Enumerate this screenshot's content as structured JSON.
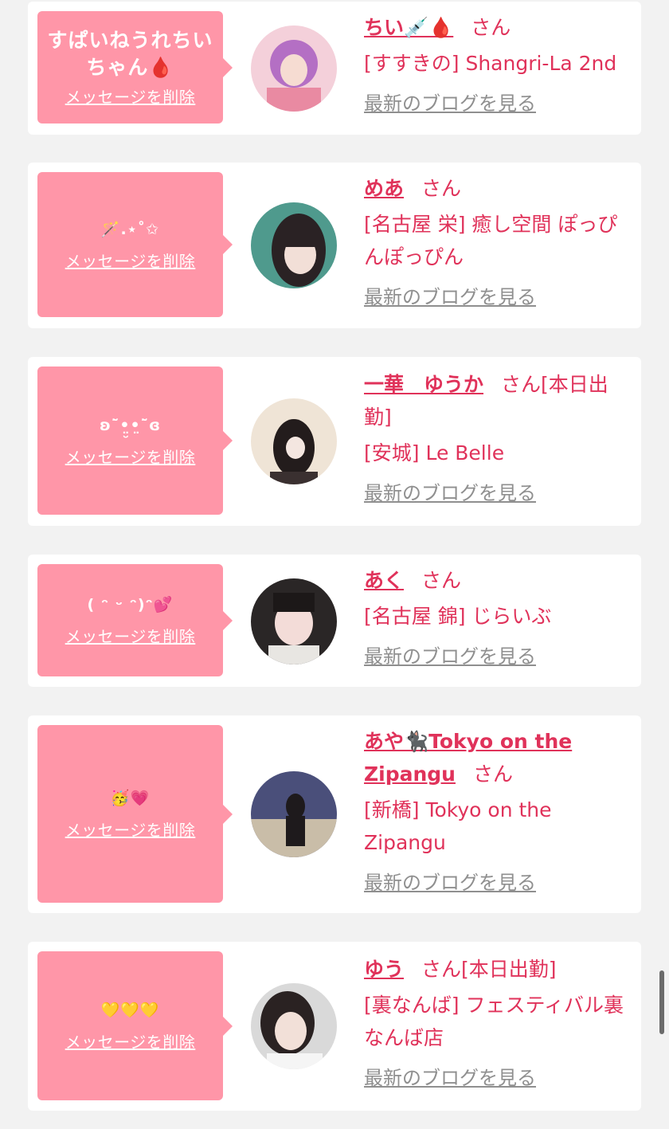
{
  "common": {
    "delete_label": "メッセージを削除",
    "san_label": "さん",
    "blog_label": "最新のブログを見る"
  },
  "messages": [
    {
      "bubble_text": "すぱいねうれちいちゃん🩸",
      "name": "ちい💉🩸",
      "suffix": "",
      "shop": "[すすきの] Shangri-La 2nd"
    },
    {
      "bubble_text": "🪄.⋆˚✩",
      "name": "めあ",
      "suffix": "",
      "shop": "[名古屋 栄] 癒し空間 ぽっぴんぽっぴん"
    },
    {
      "bubble_text": "ʚ˘̃•̤̮•̤˘̃ɞ",
      "name": "一華　ゆうか",
      "suffix": "[本日出勤]",
      "shop": "[安城] Le Belle"
    },
    {
      "bubble_text": "( ᵔ ᵕ ᵔ)ᵔ💕",
      "name": "あく",
      "suffix": "",
      "shop": "[名古屋 錦] じらいぶ"
    },
    {
      "bubble_text": "🥳💗",
      "name": "あや🐈‍⬛Tokyo on the Zipangu",
      "suffix": "",
      "shop": "[新橋] Tokyo on the Zipangu"
    },
    {
      "bubble_text": "💛💛💛",
      "name": "ゆう",
      "suffix": "[本日出勤]",
      "shop": "[裏なんば] フェスティバル裏なんば店"
    }
  ],
  "colors": {
    "accent_pink": "#e0325a",
    "bubble_pink": "#ff96a8",
    "link_gray": "#8f8f8f",
    "background": "#f2f2f2"
  }
}
